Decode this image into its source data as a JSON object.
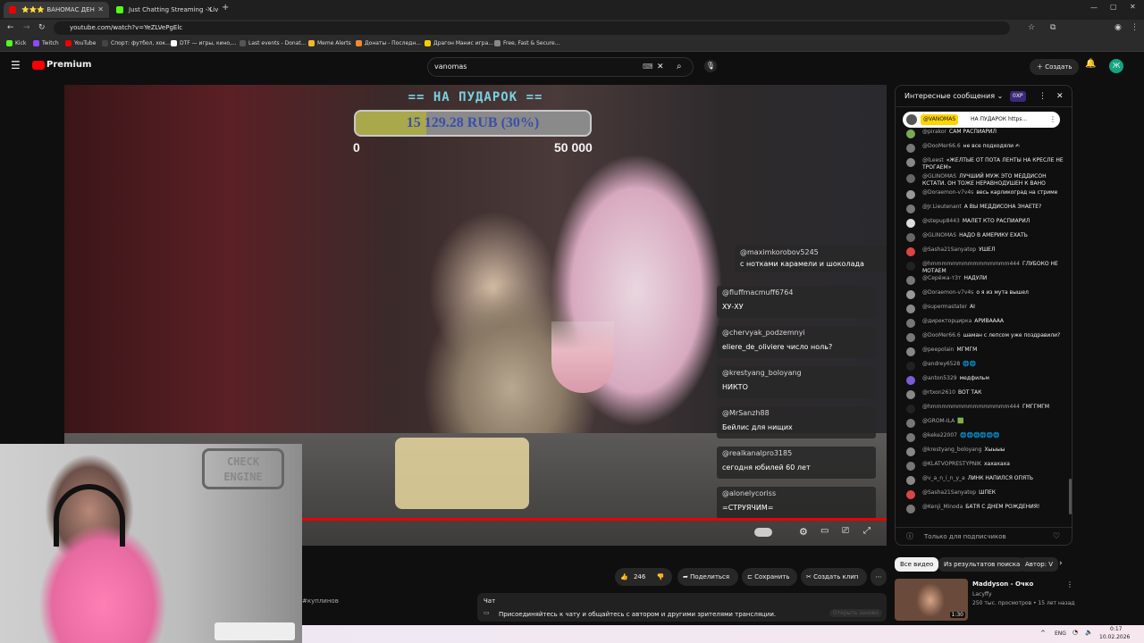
{
  "tabs": [
    {
      "label": "⭐⭐⭐ ВАНОМАС ДЕН",
      "icon": "youtube-tab-icon",
      "active": true
    },
    {
      "label": "Just Chatting Streaming - Live",
      "icon": "kick-tab-icon",
      "active": false
    }
  ],
  "address": {
    "url": "youtube.com/watch?v=YeZLVePgElc"
  },
  "bookmarks": [
    "Kick",
    "Twitch",
    "YouTube",
    "Спорт: футбол, хок...",
    "DTF — игры, кино,...",
    "Last events - Donat...",
    "Meme Alerts",
    "Донаты - Последн...",
    "Драгон Манис игра...",
    "Free, Fast & Secure..."
  ],
  "yt": {
    "logo_text": "Premium",
    "search_value": "vanomas",
    "create_label": "Создать",
    "avatar_letter": "Ж"
  },
  "overlay": {
    "goal_title": "== НА ПУДАРОК ==",
    "goal_text": "15 129.28 RUB (30%)",
    "goal_fraction": 0.3,
    "goal_min": "0",
    "goal_max": "50 000",
    "chat": [
      {
        "user": "@maximkorobov5245",
        "msg": "с нотками карамели и шоколада"
      },
      {
        "user": "@fluffmacmuff6764",
        "msg": "ХУ-ХУ"
      },
      {
        "user": "@chervyak_podzemnyi",
        "msg": "eliere_de_oliviere число ноль?"
      },
      {
        "user": "@krestyang_boloyang",
        "msg": "НИКТО"
      },
      {
        "user": "@MrSanzh88",
        "msg": "Бейлис для нищих"
      },
      {
        "user": "@realkanalpro3185",
        "msg": "сегодня юбилей 60 лет"
      },
      {
        "user": "@alonelycoriss",
        "msg": "=СТРУЯЧИМ="
      }
    ]
  },
  "cam": {
    "sign_text": "CHECK ENGINE"
  },
  "actions": {
    "like_count": "246",
    "share": "Поделиться",
    "save": "Сохранить",
    "clip": "Создать клип"
  },
  "livechat": {
    "title": "Интересные сообщения",
    "badge": "0XP",
    "pinned_user": "@VANOMAS",
    "pinned_msg": "НА ПУДАРОК https...",
    "messages": [
      {
        "user": "@pirakor",
        "msg": "САМ РАСПИАРИЛ",
        "color": "#7a5"
      },
      {
        "user": "@DooMer66.6",
        "msg": "не все подходяли ✍",
        "color": "#777"
      },
      {
        "user": "@lLeest",
        "msg": "«ЖЕЛТЫЕ ОТ ПОТА ЛЕНТЫ НА КРЕСЛЕ НЕ ТРОГАЕМ»",
        "color": "#888"
      },
      {
        "user": "@GLINOMAS",
        "msg": "ЛУЧШИЙ МУЖ ЭТО МЕДДИСОН КСТАТИ. ОН ТОЖЕ НЕРАВНОДУШЕН К ВАНО",
        "color": "#666"
      },
      {
        "user": "@Doraemon-v7v4s",
        "msg": "весь карликоград на стриме",
        "color": "#999"
      },
      {
        "user": "@Jr.Lieutenant",
        "msg": "А ВЫ МЕДДИСОНА ЗНАЕТЕ?",
        "color": "#777"
      },
      {
        "user": "@stepup8443",
        "msg": "МАЛЕТ КТО РАСПИАРИЛ",
        "color": "#ddd"
      },
      {
        "user": "@GLINOMAS",
        "msg": "НАДО В АМЕРИКУ ЕХАТЬ",
        "color": "#666"
      },
      {
        "user": "@Sasha21Sanyatop",
        "msg": "УШЕЛ",
        "color": "#d44"
      },
      {
        "user": "@hmmmmmmmmmmmmmmm444",
        "msg": "ГЛУБОКО НЕ МОТАЕМ",
        "color": "#222"
      },
      {
        "user": "@Серёжа-т3т",
        "msg": "НАДУЛИ",
        "color": "#777"
      },
      {
        "user": "@Doraemon-v7v4s",
        "msg": "о я из мута вышел",
        "color": "#999"
      },
      {
        "user": "@supermastater",
        "msg": "AI",
        "color": "#888"
      },
      {
        "user": "@директорцирка",
        "msg": "АРИВАААА",
        "color": "#777"
      },
      {
        "user": "@DooMer66.6",
        "msg": "шаман с лепсом уже поздравили?",
        "color": "#777"
      },
      {
        "user": "@peepolain",
        "msg": "МГМГМ",
        "color": "#888"
      },
      {
        "user": "@andrey6528",
        "msg": "🌐🌐",
        "color": "#222"
      },
      {
        "user": "@anton5329",
        "msg": "медфильм",
        "color": "#7b5cd6"
      },
      {
        "user": "@rtxon2610",
        "msg": "ВОТ ТАК",
        "color": "#888"
      },
      {
        "user": "@hmmmmmmmmmmmmmmm444",
        "msg": "ГМГГМГМ",
        "color": "#222"
      },
      {
        "user": "@GROM-ILA",
        "msg": "🟩",
        "color": "#777"
      },
      {
        "user": "@keke22007",
        "msg": "🌐🌐🌐🌐🌐🌐",
        "color": "#777"
      },
      {
        "user": "@krestyang_boloyang",
        "msg": "Xыыыы",
        "color": "#888"
      },
      {
        "user": "@KLATVOPRESTYPNIK",
        "msg": "хахахаха",
        "color": "#777"
      },
      {
        "user": "@v_a_n_i_n_y_a",
        "msg": "ЛИНК НАПИЛСЯ ОПЯТЬ",
        "color": "#888"
      },
      {
        "user": "@Sasha21Sanyatop",
        "msg": "ШПЕК",
        "color": "#d44"
      },
      {
        "user": "@Kenji_Minoda",
        "msg": "БАТЯ С ДНЕМ РОЖДЕНИЯ!",
        "color": "#777"
      }
    ],
    "input_placeholder": "Только для подписчиков"
  },
  "related": {
    "chips": [
      "Все видео",
      "Из результатов поиска",
      "Автор: V"
    ],
    "video_title": "Maddyson - Очко",
    "video_channel": "Lacyffy",
    "video_meta": "250 тыс. просмотров • 15 лет назад",
    "video_duration": "1:30"
  },
  "lower": {
    "left_user": "#куплинов",
    "chat_label": "Чат",
    "chat_msg": "Присоединяйтесь к чату и общайтесь с автором и другими зрителями трансляции.",
    "chat_btn": "Открыть заново"
  },
  "taskbar": {
    "lang": "ENG",
    "time": "0:17",
    "date": "10.02.2026"
  }
}
